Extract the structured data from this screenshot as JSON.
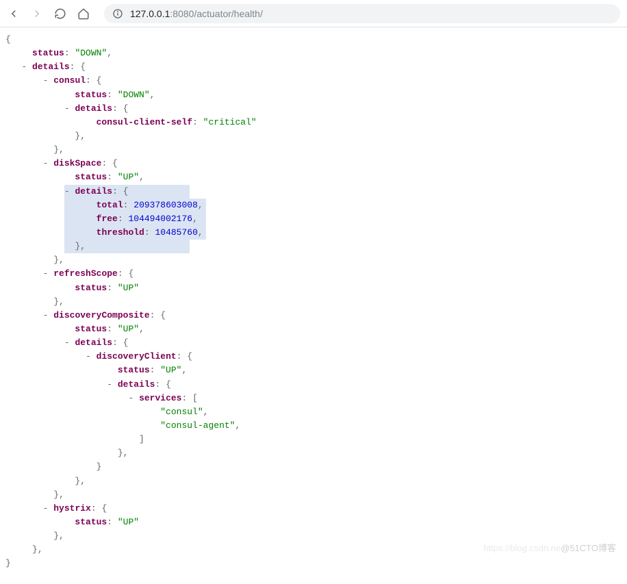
{
  "toolbar": {
    "url_host": "127.0.0.1",
    "url_port": ":8080",
    "url_path": "/actuator/health/"
  },
  "json": {
    "status_key": "status",
    "status_val": "\"DOWN\"",
    "details_key": "details",
    "consul": {
      "key": "consul",
      "status_key": "status",
      "status_val": "\"DOWN\"",
      "details_key": "details",
      "client_key": "consul-client-self",
      "client_val": "\"critical\""
    },
    "diskSpace": {
      "key": "diskSpace",
      "status_key": "status",
      "status_val": "\"UP\"",
      "details_key": "details",
      "total_key": "total",
      "total_val": "209378603008",
      "free_key": "free",
      "free_val": "104494002176",
      "threshold_key": "threshold",
      "threshold_val": "10485760"
    },
    "refreshScope": {
      "key": "refreshScope",
      "status_key": "status",
      "status_val": "\"UP\""
    },
    "discoveryComposite": {
      "key": "discoveryComposite",
      "status_key": "status",
      "status_val": "\"UP\"",
      "details_key": "details",
      "discoveryClient": {
        "key": "discoveryClient",
        "status_key": "status",
        "status_val": "\"UP\"",
        "details_key": "details",
        "services_key": "services",
        "service0": "\"consul\"",
        "service1": "\"consul-agent\""
      }
    },
    "hystrix": {
      "key": "hystrix",
      "status_key": "status",
      "status_val": "\"UP\""
    }
  },
  "watermark": {
    "faded": "https://blog.csdn.ne",
    "main": "@51CTO博客"
  }
}
